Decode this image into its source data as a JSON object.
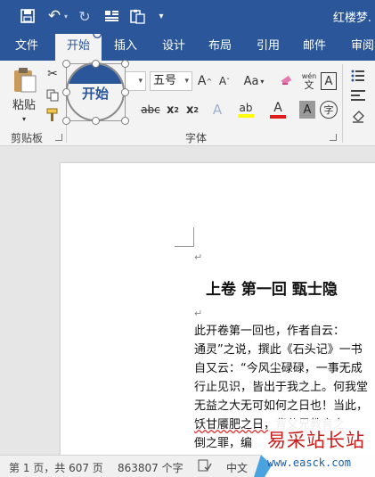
{
  "title_bar": {
    "doc_title": "红楼梦.",
    "qat": [
      {
        "name": "save-icon",
        "glyph": "🖫"
      },
      {
        "name": "undo-icon",
        "glyph": "↶"
      },
      {
        "name": "redo-icon",
        "glyph": "↻"
      },
      {
        "name": "layout-icon",
        "glyph": "⬒"
      },
      {
        "name": "clipboard-icon",
        "glyph": "📋"
      },
      {
        "name": "customize-qat-icon",
        "glyph": "▾"
      }
    ]
  },
  "tabs": [
    "文件",
    "开始",
    "插入",
    "设计",
    "布局",
    "引用",
    "邮件",
    "审阅"
  ],
  "active_tab": "开始",
  "ribbon": {
    "paste_label": "粘贴",
    "clipboard_group_label": "剪贴板",
    "font_group_label": "字体",
    "font_size": "五号",
    "grow_font": "A",
    "shrink_font": "A",
    "change_case": "Aa",
    "phonetic_top": "wén",
    "phonetic_bottom": "文",
    "char_border": "A",
    "strikethrough": "abc",
    "subscript": "x",
    "superscript": "x",
    "text_effect": "A",
    "highlight": "ab",
    "font_color": "A",
    "char_shading": "A",
    "enclose_char": "字"
  },
  "callout": {
    "label": "开始"
  },
  "document": {
    "heading": "上卷  第一回    甄士隐",
    "paragraph_lines": [
      "    此开卷第一回也，作者自云：",
      "通灵”之说，撰此《石头记》一书",
      "自又云：“今风尘碌碌，一事无成",
      "行止见识，皆出于我之上。何我堂",
      "无益之大无可如何之日也！当此，",
      "饫甘餍肥之日，背父兄教育之",
      "倒之罪，编"
    ]
  },
  "status_bar": {
    "page": "第 1 页，共 607 页",
    "word_count": "863807 个字",
    "language": "中文"
  },
  "watermark": {
    "cn": "易采站长站",
    "url": "www.easck.com"
  },
  "colors": {
    "accent": "#2b579a",
    "ribbon_bg": "#f3f3f3",
    "watermark_red": "#c81e1e",
    "watermark_blue": "#1d5fa6"
  }
}
